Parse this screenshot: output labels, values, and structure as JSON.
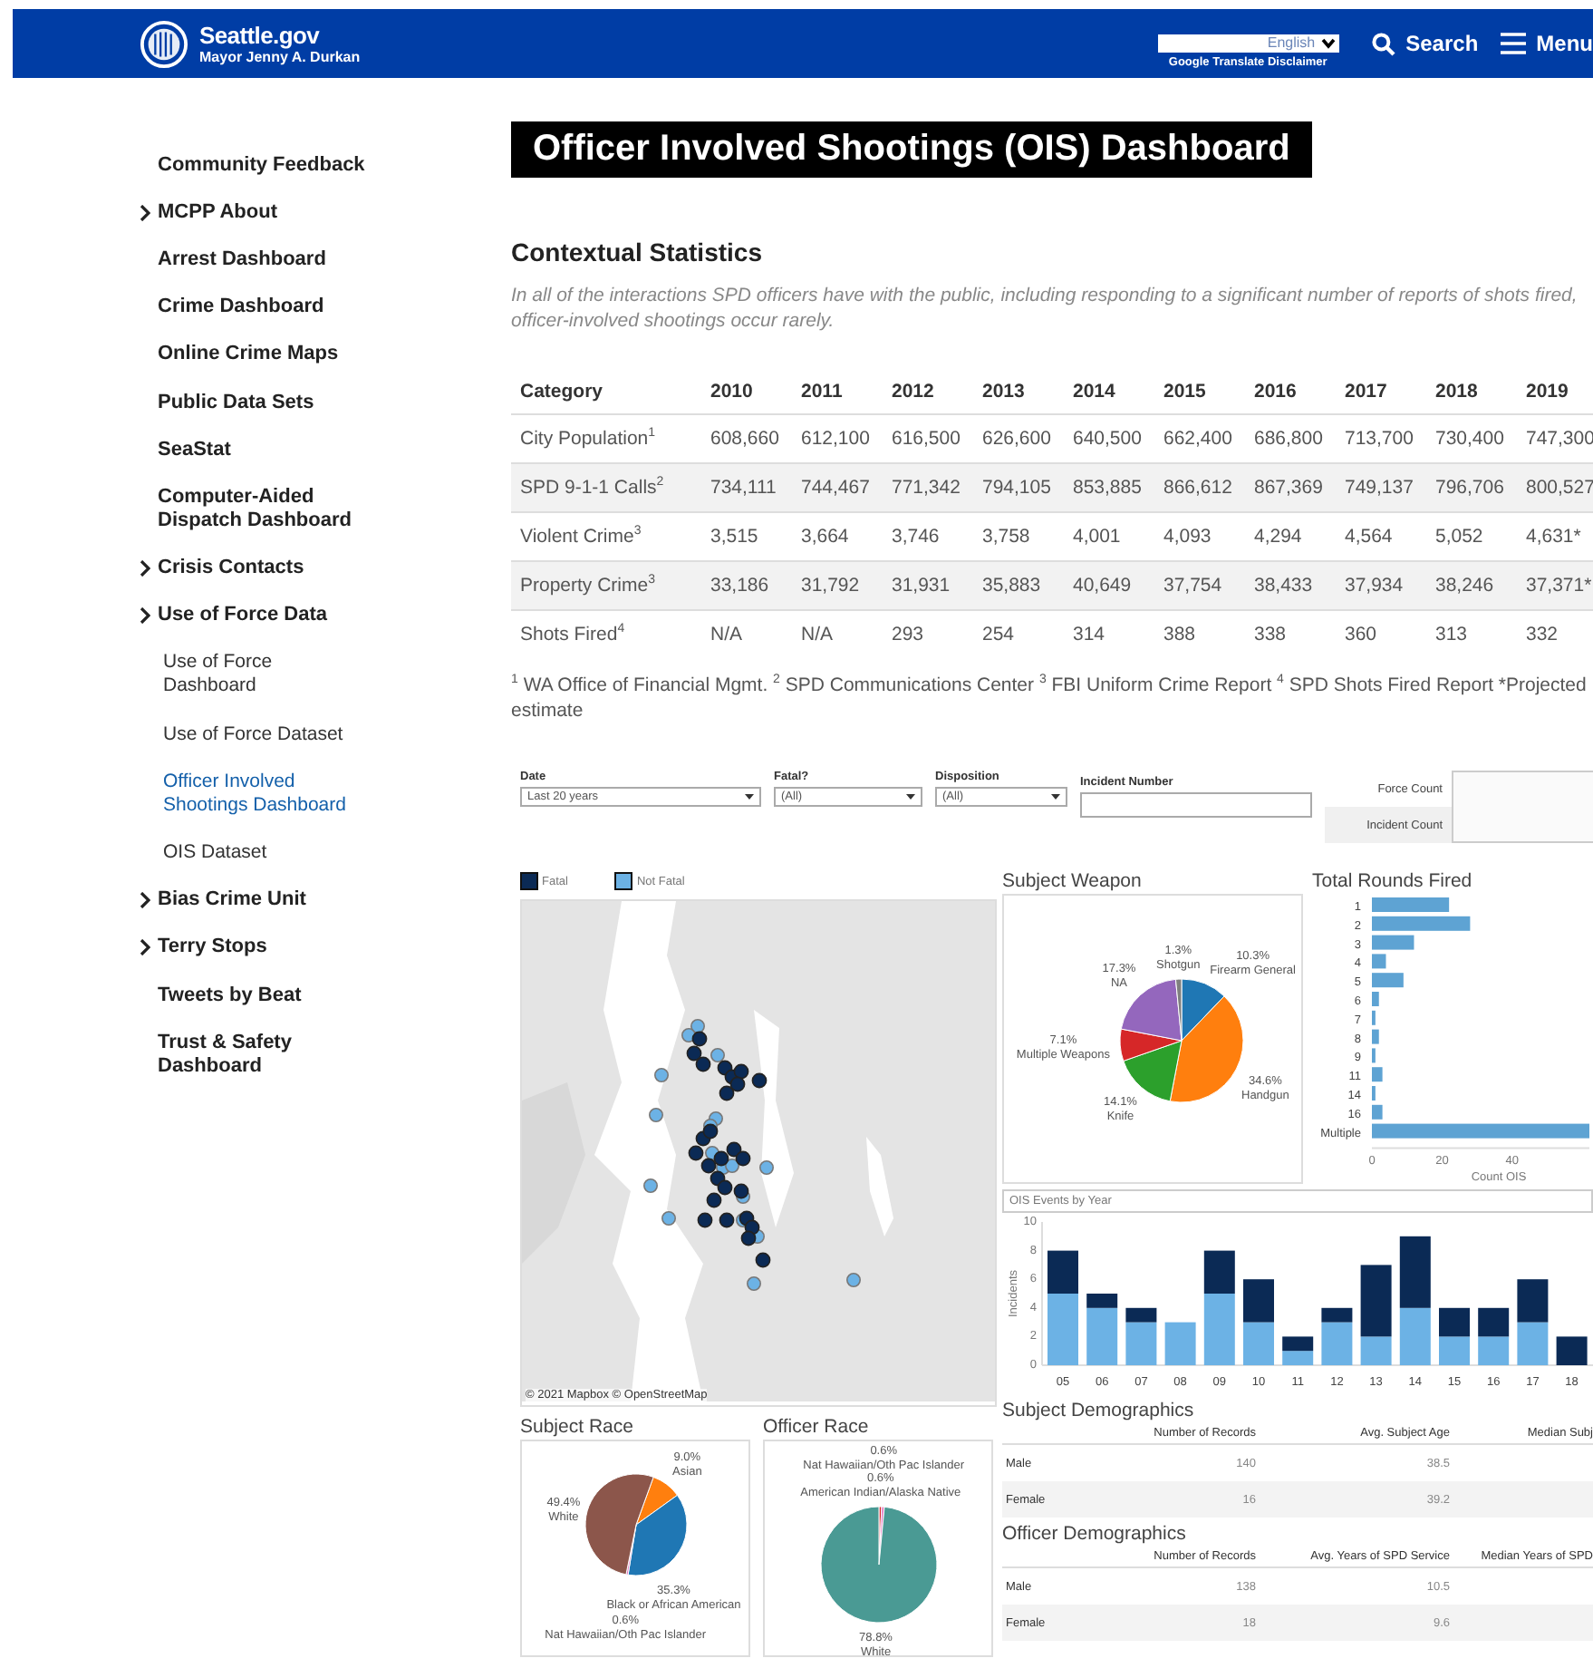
{
  "header": {
    "site_name": "Seattle.gov",
    "subtitle": "Mayor Jenny A. Durkan",
    "language": "English",
    "translate_disclaimer": "Google Translate Disclaimer",
    "search": "Search",
    "menu": "Menu"
  },
  "sidebar": {
    "items": [
      {
        "label": "Community Feedback",
        "expandable": false,
        "selected": false
      },
      {
        "label": "MCPP About",
        "expandable": true,
        "selected": false
      },
      {
        "label": "Arrest Dashboard",
        "expandable": false,
        "selected": false
      },
      {
        "label": "Crime Dashboard",
        "expandable": false,
        "selected": false
      },
      {
        "label": "Online Crime Maps",
        "expandable": false,
        "selected": false
      },
      {
        "label": "Public Data Sets",
        "expandable": false,
        "selected": false
      },
      {
        "label": "SeaStat",
        "expandable": false,
        "selected": false
      },
      {
        "label": "Computer-Aided Dispatch Dashboard",
        "expandable": false,
        "selected": false
      },
      {
        "label": "Crisis Contacts",
        "expandable": true,
        "selected": false
      },
      {
        "label": "Use of Force Data",
        "expandable": true,
        "selected": false,
        "children": [
          {
            "label": "Use of Force Dashboard",
            "selected": false
          },
          {
            "label": "Use of Force Dataset",
            "selected": false
          },
          {
            "label": "Officer Involved Shootings Dashboard",
            "selected": true
          },
          {
            "label": "OIS Dataset",
            "selected": false
          }
        ]
      },
      {
        "label": "Bias Crime Unit",
        "expandable": true,
        "selected": false
      },
      {
        "label": "Terry Stops",
        "expandable": true,
        "selected": false
      },
      {
        "label": "Tweets by Beat",
        "expandable": false,
        "selected": false
      },
      {
        "label": "Trust & Safety Dashboard",
        "expandable": false,
        "selected": false
      }
    ]
  },
  "main": {
    "title": "Officer Involved Shootings (OIS) Dashboard",
    "section_heading": "Contextual Statistics",
    "intro": "In all of the interactions SPD officers have with the public, including responding to a significant number of reports of shots fired, officer-involved shootings occur rarely.",
    "stats_table": {
      "columns": [
        "Category",
        "2010",
        "2011",
        "2012",
        "2013",
        "2014",
        "2015",
        "2016",
        "2017",
        "2018",
        "2019"
      ],
      "rows": [
        {
          "cells": [
            "City Population$^{1}$",
            "608,660",
            "612,100",
            "616,500",
            "626,600",
            "640,500",
            "662,400",
            "686,800",
            "713,700",
            "730,400",
            "747,300"
          ]
        },
        {
          "cells": [
            "SPD 9-1-1 Calls$^{2}$",
            "734,111",
            "744,467",
            "771,342",
            "794,105",
            "853,885",
            "866,612",
            "867,369",
            "749,137",
            "796,706",
            "800,527"
          ]
        },
        {
          "cells": [
            "Violent Crime$^{3}$",
            "3,515",
            "3,664",
            "3,746",
            "3,758",
            "4,001",
            "4,093",
            "4,294",
            "4,564",
            "5,052",
            "4,631*"
          ]
        },
        {
          "cells": [
            "Property Crime$^{3}$",
            "33,186",
            "31,792",
            "31,931",
            "35,883",
            "40,649",
            "37,754",
            "38,433",
            "37,934",
            "38,246",
            "37,371*"
          ]
        },
        {
          "cells": [
            "Shots Fired$^{4}$",
            "N/A",
            "N/A",
            "293",
            "254",
            "314",
            "388",
            "338",
            "360",
            "313",
            "332"
          ]
        }
      ]
    },
    "footnote": "$^{1}$ WA Office of Financial Mgmt. $^{2}$ SPD Communications Center $^{3}$ FBI Uniform Crime Report $^{4}$ SPD Shots Fired Report *Projected estimate"
  },
  "dashboard": {
    "filters": [
      {
        "label": "Date",
        "kind": "dropdown",
        "value": "Last 20 years"
      },
      {
        "label": "Fatal?",
        "kind": "dropdown",
        "value": "(All)"
      },
      {
        "label": "Disposition",
        "kind": "dropdown",
        "value": "(All)"
      },
      {
        "label": "Incident Number",
        "kind": "text"
      }
    ],
    "counts": [
      "Force Count",
      "Incident Count"
    ],
    "map": {
      "attribution": "© 2021 Mapbox © OpenStreetMap"
    },
    "subject_weapon": {
      "title": "Subject Weapon",
      "chart_data": {
        "type": "pie",
        "categories": [
          "Firearm General",
          "Handgun",
          "Knife",
          "Multiple Weapons",
          "NA",
          "Shotgun"
        ],
        "values": [
          10.3,
          34.6,
          14.1,
          7.1,
          17.3,
          1.3
        ],
        "colors": [
          "#1f77b4",
          "#ff7f0e",
          "#2ca02c",
          "#d62728",
          "#9467bd",
          "#7f7f7f"
        ],
        "value_labels": [
          "10.3%",
          "34.6%",
          "14.1%",
          "7.1%",
          "17.3%",
          "1.3%"
        ]
      }
    },
    "rounds_fired": {
      "title": "Total Rounds Fired",
      "chart_data": {
        "type": "bar",
        "orientation": "horizontal",
        "categories": [
          "1",
          "2",
          "3",
          "4",
          "5",
          "6",
          "7",
          "8",
          "9",
          "11",
          "14",
          "16",
          "Multiple"
        ],
        "values": [
          22,
          28,
          12,
          4,
          9,
          2,
          1,
          2,
          1,
          3,
          1,
          3,
          62
        ],
        "xlabel": "Count OIS",
        "xlim": [
          0,
          62
        ],
        "xticks": [
          0,
          20,
          40
        ]
      }
    },
    "events_by_year": {
      "title": "OIS Events by Year",
      "chart_data": {
        "type": "bar",
        "stacked": true,
        "ylabel": "Incidents",
        "categories": [
          "05",
          "06",
          "07",
          "08",
          "09",
          "10",
          "11",
          "12",
          "13",
          "14",
          "15",
          "16",
          "17",
          "18"
        ],
        "ylim": [
          0,
          10
        ],
        "yticks": [
          0,
          2,
          4,
          6,
          8,
          10
        ],
        "series": [
          {
            "name": "Not Fatal",
            "color": "#6cb2e5",
            "values": [
              5,
              4,
              3,
              3,
              5,
              3,
              1,
              3,
              2,
              4,
              2,
              2,
              3,
              0
            ]
          },
          {
            "name": "Fatal",
            "color": "#0b2a55",
            "values": [
              3,
              1,
              1,
              0,
              3,
              3,
              1,
              1,
              5,
              5,
              2,
              2,
              3,
              2
            ]
          }
        ]
      }
    },
    "subject_race": {
      "title": "Subject Race",
      "chart_data": {
        "type": "pie",
        "categories": [
          "Asian",
          "Black or African American",
          "Nat Hawaiian/Oth Pac Islander",
          "White"
        ],
        "values": [
          9.0,
          35.3,
          0.6,
          49.4
        ],
        "colors": [
          "#ff7f0e",
          "#1f77b4",
          "#e377c2",
          "#8c564b"
        ],
        "value_labels": [
          "9.0%",
          "35.3%",
          "0.6%",
          "49.4%"
        ]
      }
    },
    "officer_race": {
      "title": "Officer Race",
      "chart_data": {
        "type": "pie",
        "categories": [
          "American Indian/Alaska Native",
          "Nat Hawaiian/Oth Pac Islander",
          "White"
        ],
        "values": [
          0.6,
          0.6,
          78.8
        ],
        "colors": [
          "#d62728",
          "#e377c2",
          "#4a9a94"
        ],
        "value_labels": [
          "0.6%",
          "0.6%",
          "78.8%"
        ]
      }
    },
    "subject_demographics": {
      "title": "Subject Demographics",
      "columns": [
        "Number of Records",
        "Avg. Subject Age",
        "Median Subj"
      ],
      "rows": [
        {
          "label": "Male",
          "cells": [
            "140",
            "38.5"
          ]
        },
        {
          "label": "Female",
          "cells": [
            "16",
            "39.2"
          ]
        }
      ]
    },
    "officer_demographics": {
      "title": "Officer Demographics",
      "columns": [
        "Number of Records",
        "Avg. Years of SPD Service",
        "Median Years of SPD"
      ],
      "rows": [
        {
          "label": "Male",
          "cells": [
            "138",
            "10.5"
          ]
        },
        {
          "label": "Female",
          "cells": [
            "18",
            "9.6"
          ]
        }
      ]
    }
  }
}
